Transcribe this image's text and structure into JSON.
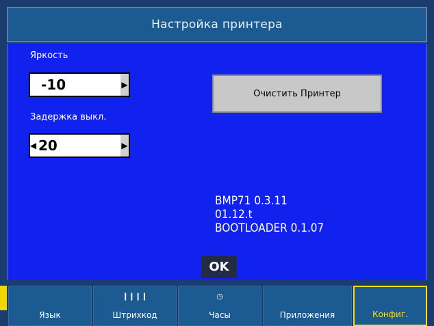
{
  "title": "Настройка принтера",
  "brightness": {
    "label": "Яркость",
    "value": "-10"
  },
  "off_delay": {
    "label": "Задержка выкл.",
    "value": "20"
  },
  "clear_button": "Очистить Принтер",
  "info": [
    "BMP71 0.3.11",
    "01.12.t",
    "BOOTLOADER 0.1.07"
  ],
  "ok_label": "OK",
  "tabs": [
    {
      "label": "Язык",
      "icon": ""
    },
    {
      "label": "Штрихкод",
      "icon": "barcode-icon"
    },
    {
      "label": "Часы",
      "icon": "clock-icon"
    },
    {
      "label": "Приложения",
      "icon": ""
    },
    {
      "label": "Конфиг.",
      "icon": "",
      "active": true
    }
  ],
  "colors": {
    "panel": "#1122ee",
    "header": "#1c5a92",
    "active_tab": "#ffe000"
  }
}
